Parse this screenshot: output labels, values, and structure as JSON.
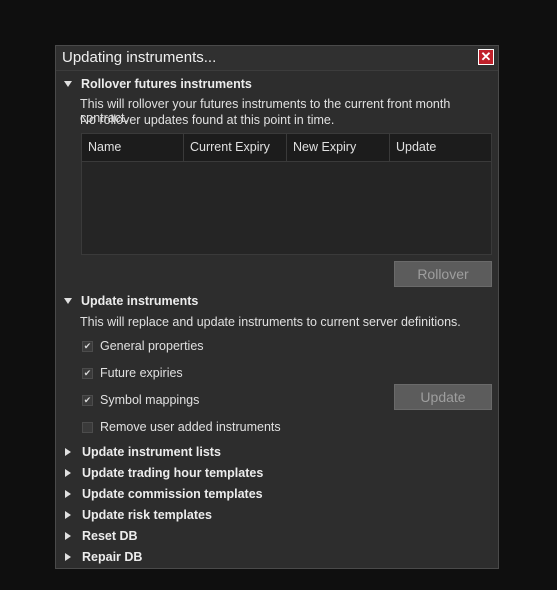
{
  "window": {
    "title": "Updating instruments...",
    "close_icon": "close-icon"
  },
  "rollover": {
    "header": "Rollover futures instruments",
    "desc_line1": "This will rollover your futures instruments to the current front month contract.",
    "desc_line2": "No rollover updates found at this point in time.",
    "columns": [
      "Name",
      "Current Expiry",
      "New Expiry",
      "Update"
    ],
    "button": "Rollover"
  },
  "update_instruments": {
    "header": "Update instruments",
    "desc": "This will replace and update instruments to current server definitions.",
    "options": [
      {
        "label": "General properties",
        "checked": true
      },
      {
        "label": "Future expiries",
        "checked": true
      },
      {
        "label": "Symbol mappings",
        "checked": true
      },
      {
        "label": "Remove user added instruments",
        "checked": false
      }
    ],
    "button": "Update"
  },
  "collapsed_sections": [
    "Update instrument lists",
    "Update trading hour templates",
    "Update commission templates",
    "Update risk templates",
    "Reset DB",
    "Repair DB"
  ],
  "colors": {
    "background": "#0f0f0f",
    "dialog": "#2d2d2d",
    "close_button": "#c0202a",
    "disabled_button": "#5c5c5c"
  }
}
